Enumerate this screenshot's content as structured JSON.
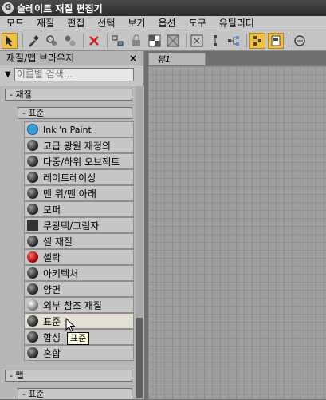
{
  "window": {
    "title": "슬레이트 재질 편집기",
    "icon": "app-logo-icon"
  },
  "menu": [
    "모드",
    "재질",
    "편집",
    "선택",
    "보기",
    "옵션",
    "도구",
    "유틸리티"
  ],
  "toolbar": {
    "icons": [
      "select-arrow-icon",
      "eyedropper-icon",
      "put-to-scene-icon",
      "assign-icon",
      "delete-icon",
      "move-children-icon",
      "lock-icon",
      "checker-icon",
      "background-icon",
      "grid-icon",
      "layout-icon",
      "hierarchy-icon",
      "show-icon",
      "options-icon",
      "nav-icon"
    ]
  },
  "browser": {
    "title": "재질/맵 브라우저",
    "close": "×",
    "search_placeholder": "이름별 검색...",
    "group_materials": "- 재질",
    "subgroup_standard": "- 표준",
    "items": [
      {
        "label": "Ink 'n Paint",
        "swatch": "ink"
      },
      {
        "label": "고급 광원 재정의",
        "swatch": "dark"
      },
      {
        "label": "다중/하위 오브젝트",
        "swatch": "dark"
      },
      {
        "label": "레이트레이싱",
        "swatch": "dark"
      },
      {
        "label": "맨 위/맨 아래",
        "swatch": "dark"
      },
      {
        "label": "모퍼",
        "swatch": "dark"
      },
      {
        "label": "무광택/그림자",
        "swatch": "square"
      },
      {
        "label": "셸 재질",
        "swatch": "dark"
      },
      {
        "label": "셸락",
        "swatch": "red"
      },
      {
        "label": "아키텍처",
        "swatch": "dark"
      },
      {
        "label": "양면",
        "swatch": "dark"
      },
      {
        "label": "외부 참조 재질",
        "swatch": "white"
      },
      {
        "label": "표준",
        "swatch": "dark"
      },
      {
        "label": "합성",
        "swatch": "dark"
      },
      {
        "label": "혼합",
        "swatch": "dark"
      }
    ],
    "group_maps": "- 맵",
    "subgroup_maps_standard": "- 표준",
    "tooltip": "표준"
  },
  "view": {
    "tab_label": "뷰1"
  }
}
